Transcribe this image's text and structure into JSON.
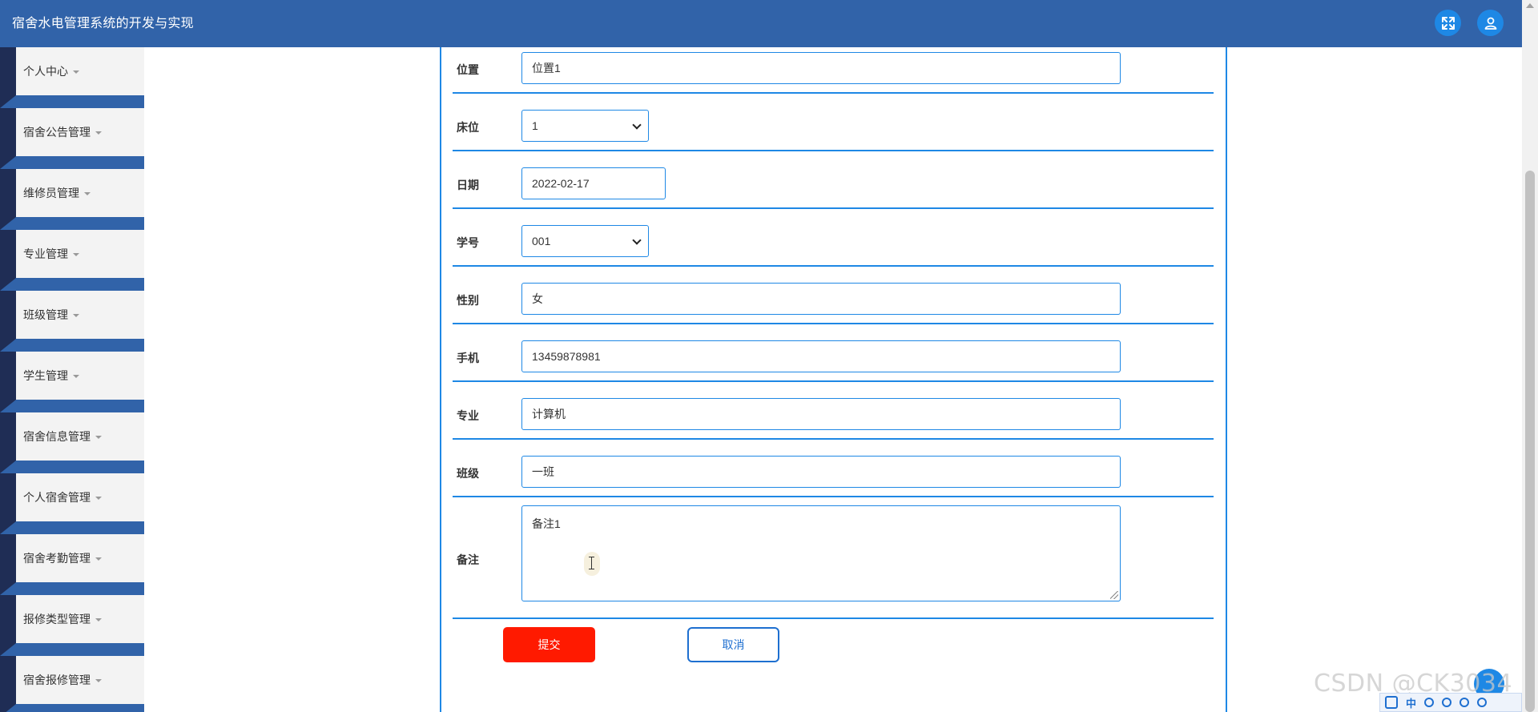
{
  "app": {
    "title": "宿舍水电管理系统的开发与实现"
  },
  "header": {
    "fullscreen_icon": "expand-icon",
    "user_icon": "user-icon",
    "accent_color": "#3163a9",
    "button_color": "#1e88e5"
  },
  "sidebar": {
    "items": [
      {
        "label": "个人中心"
      },
      {
        "label": "宿舍公告管理"
      },
      {
        "label": "维修员管理"
      },
      {
        "label": "专业管理"
      },
      {
        "label": "班级管理"
      },
      {
        "label": "学生管理"
      },
      {
        "label": "宿舍信息管理"
      },
      {
        "label": "个人宿舍管理"
      },
      {
        "label": "宿舍考勤管理"
      },
      {
        "label": "报修类型管理"
      },
      {
        "label": "宿舍报修管理"
      }
    ]
  },
  "form": {
    "fields": [
      {
        "label": "位置",
        "value": "位置1"
      },
      {
        "label": "床位",
        "value": "1"
      },
      {
        "label": "日期",
        "value": "2022-02-17"
      },
      {
        "label": "学号",
        "value": "001"
      },
      {
        "label": "性别",
        "value": "女"
      },
      {
        "label": "手机",
        "value": "13459878981"
      },
      {
        "label": "专业",
        "value": "计算机"
      },
      {
        "label": "班级",
        "value": "一班"
      },
      {
        "label": "备注",
        "value": "备注1"
      }
    ],
    "submit_label": "提交",
    "cancel_label": "取消",
    "submit_color": "#ff1a00",
    "cancel_color": "#1e6fd0"
  },
  "overlay": {
    "watermark": "CSDN @CK3034",
    "ime_text": "中"
  }
}
